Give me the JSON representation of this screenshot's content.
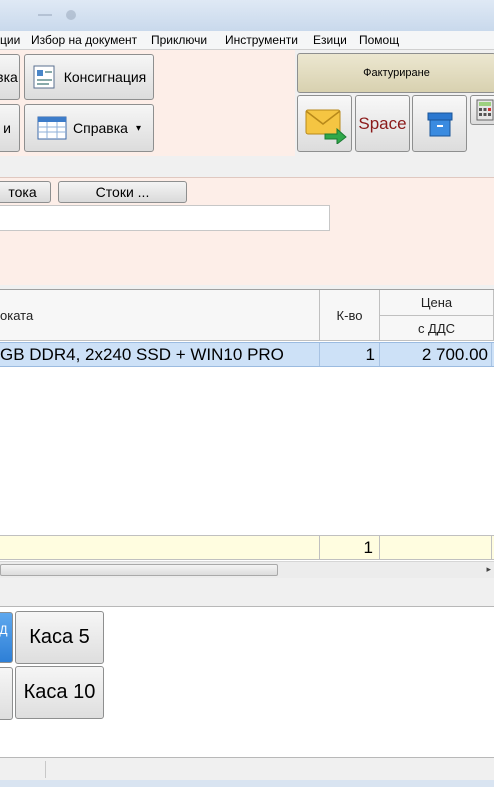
{
  "menu": {
    "items": [
      "ции",
      "Избор на документ",
      "Приключи",
      "Инструменти",
      "Езици",
      "Помощ"
    ]
  },
  "toolbar": {
    "btn_partial_top": "вка",
    "btn_consignment": "Консигнация",
    "btn_partial_bottom": "и",
    "btn_report": "Справка",
    "btn_invoicing": "Фактуриране",
    "btn_space": "Space"
  },
  "search": {
    "tab_partial": "тока",
    "tab_goods": "Стоки ...",
    "input_value": ""
  },
  "grid": {
    "header": {
      "name": "оката",
      "qty": "К-во",
      "price": "Цена",
      "price_sub": "с ДДС"
    },
    "rows": [
      {
        "name": "GB DDR4, 2x240 SSD + WIN10 PRO",
        "qty": "1",
        "price": "2 700.00"
      }
    ],
    "total": {
      "qty": "1"
    }
  },
  "kasa": {
    "partial_active": "Д",
    "k5": "Каса 5",
    "k10": "Каса 10"
  },
  "colors": {
    "accent_blue": "#2e7fd6",
    "selected_row": "#cde1f7",
    "panel_pink": "#fdeee8",
    "total_row": "#fffde0"
  }
}
